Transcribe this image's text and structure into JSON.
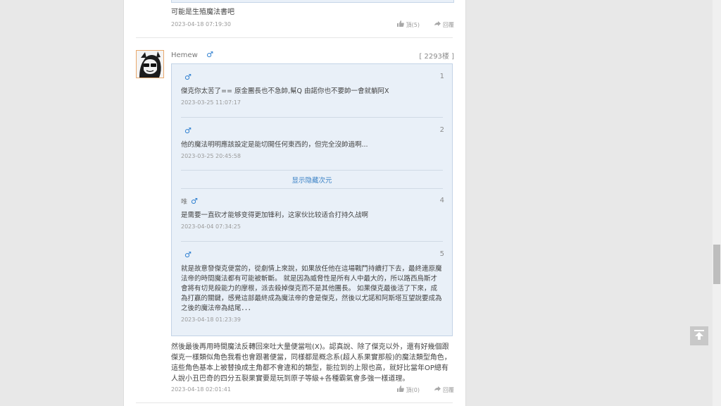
{
  "prev_post": {
    "text": "可能是生殖魔法書吧",
    "time": "2023-04-18 07:19:30",
    "like_label": "頂(5)",
    "reply_label": "回覆"
  },
  "post": {
    "username": "Hemew",
    "gender_icon": "♂",
    "floor": "[ 2293楼 ]",
    "quotes": [
      {
        "name": "",
        "num": "1",
        "text": "傑克你太苦了== 原金團長也不急帥,幫Q 由諾你也不要帥一會就躺阿X",
        "time": "2023-03-25 11:07:17"
      },
      {
        "name": "",
        "num": "2",
        "text": "他的魔法明明應該設定是能切開任何東西的，但完全沒帥過啊...",
        "time": "2023-03-25 20:45:58"
      },
      {
        "name": "唯",
        "num": "4",
        "text": "是需要一直砍才能够变得更加锋利，这家伙比较适合打持久战啊",
        "time": "2023-04-04 07:34:25"
      },
      {
        "name": "",
        "num": "5",
        "text": "就是故意發傑克便當的，從劇情上來說，如果放任他在這場戰鬥持續打下去，最終連原魔法帝的時間魔法都有可能被斬斷。 就是因為威脅性是所有人中最大的，所以路西烏斯才會將有切見殺能力的摩根，派去殺掉傑克而不是其他團長。 如果傑克最後活了下來，成為打贏的關鍵，感覺這部最終成為魔法帝的會是傑克，然後以尤諾和阿斯塔互望說要成為之後的魔法帝為結尾．．．",
        "time": "2023-04-18 01:23:39"
      }
    ],
    "show_hidden_label": "显示隐藏次元",
    "text": "然後最後再用時間魔法反轉回來吐大量便當啦(X)。認真說、除了傑克以外，還有好幾個跟傑克一樣類似角色我看也會跟著便當，同樣都是概念系(超人系果實那般)的魔法類型角色，這些角色基本上被替換成主角都不會違和的類型，能拉到的上限也高，就好比當年OP總有人說小丑巴奇的四分五裂果實要是玩到原子等級+各種霸氣會多強一樣道理。",
    "time": "2023-04-18 02:01:41",
    "like_label": "頂(0)",
    "reply_label": "回覆"
  },
  "colors": {
    "accent": "#3b82c6",
    "male_icon": "#2e7fd0",
    "quote_bg": "#e9f0f8"
  }
}
